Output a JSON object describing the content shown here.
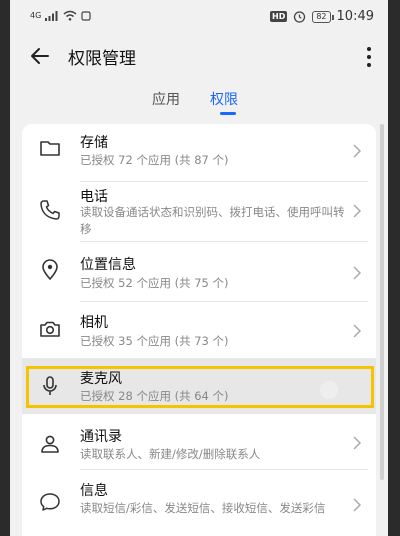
{
  "status_bar": {
    "signal_label": "4G",
    "time": "10:49",
    "battery": "82",
    "hd_badge": "HD"
  },
  "app_bar": {
    "title": "权限管理"
  },
  "tabs": [
    {
      "label": "应用",
      "active": false
    },
    {
      "label": "权限",
      "active": true
    }
  ],
  "permissions": [
    {
      "icon": "folder-icon",
      "label": "存储",
      "desc": "已授权 72 个应用 (共 87 个)"
    },
    {
      "icon": "phone-icon",
      "label": "电话",
      "desc": "读取设备通话状态和识别码、拨打电话、使用呼叫转移"
    },
    {
      "icon": "location-icon",
      "label": "位置信息",
      "desc": "已授权 52 个应用 (共 75 个)"
    },
    {
      "icon": "camera-icon",
      "label": "相机",
      "desc": "已授权 35 个应用 (共 73 个)"
    },
    {
      "icon": "microphone-icon",
      "label": "麦克风",
      "desc": "已授权 28 个应用 (共 64 个)"
    },
    {
      "icon": "contacts-icon",
      "label": "通讯录",
      "desc": "读取联系人、新建/修改/删除联系人"
    },
    {
      "icon": "message-icon",
      "label": "信息",
      "desc": "读取短信/彩信、发送短信、接收短信、发送彩信"
    }
  ],
  "colors": {
    "accent": "#1a66ff",
    "highlight": "#f5c400"
  }
}
